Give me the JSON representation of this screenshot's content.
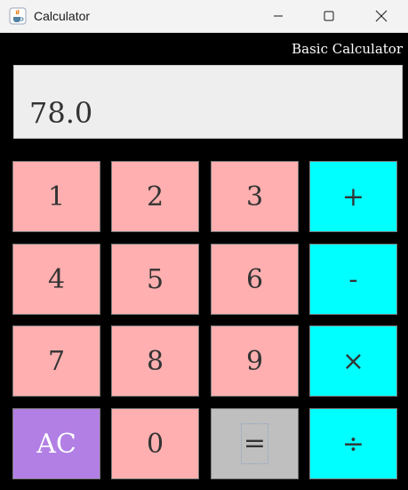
{
  "window": {
    "title": "Calculator"
  },
  "header": {
    "subtitle": "Basic Calculator"
  },
  "display": {
    "value": "78.0"
  },
  "keys": {
    "k1": "1",
    "k2": "2",
    "k3": "3",
    "add": "+",
    "k4": "4",
    "k5": "5",
    "k6": "6",
    "subtract": "-",
    "k7": "7",
    "k8": "8",
    "k9": "9",
    "multiply": "×",
    "clear": "AC",
    "k0": "0",
    "equals": "=",
    "divide": "÷"
  },
  "colors": {
    "number_key": "#ffafaf",
    "operator_key": "#00ffff",
    "clear_key": "#b27fe4",
    "equals_key": "#bfbfbf",
    "background": "#000000",
    "display": "#eeeeee"
  },
  "icons": {
    "app": "java-coffee-cup-icon",
    "minimize": "minimize-icon",
    "maximize": "maximize-icon",
    "close": "close-icon"
  }
}
